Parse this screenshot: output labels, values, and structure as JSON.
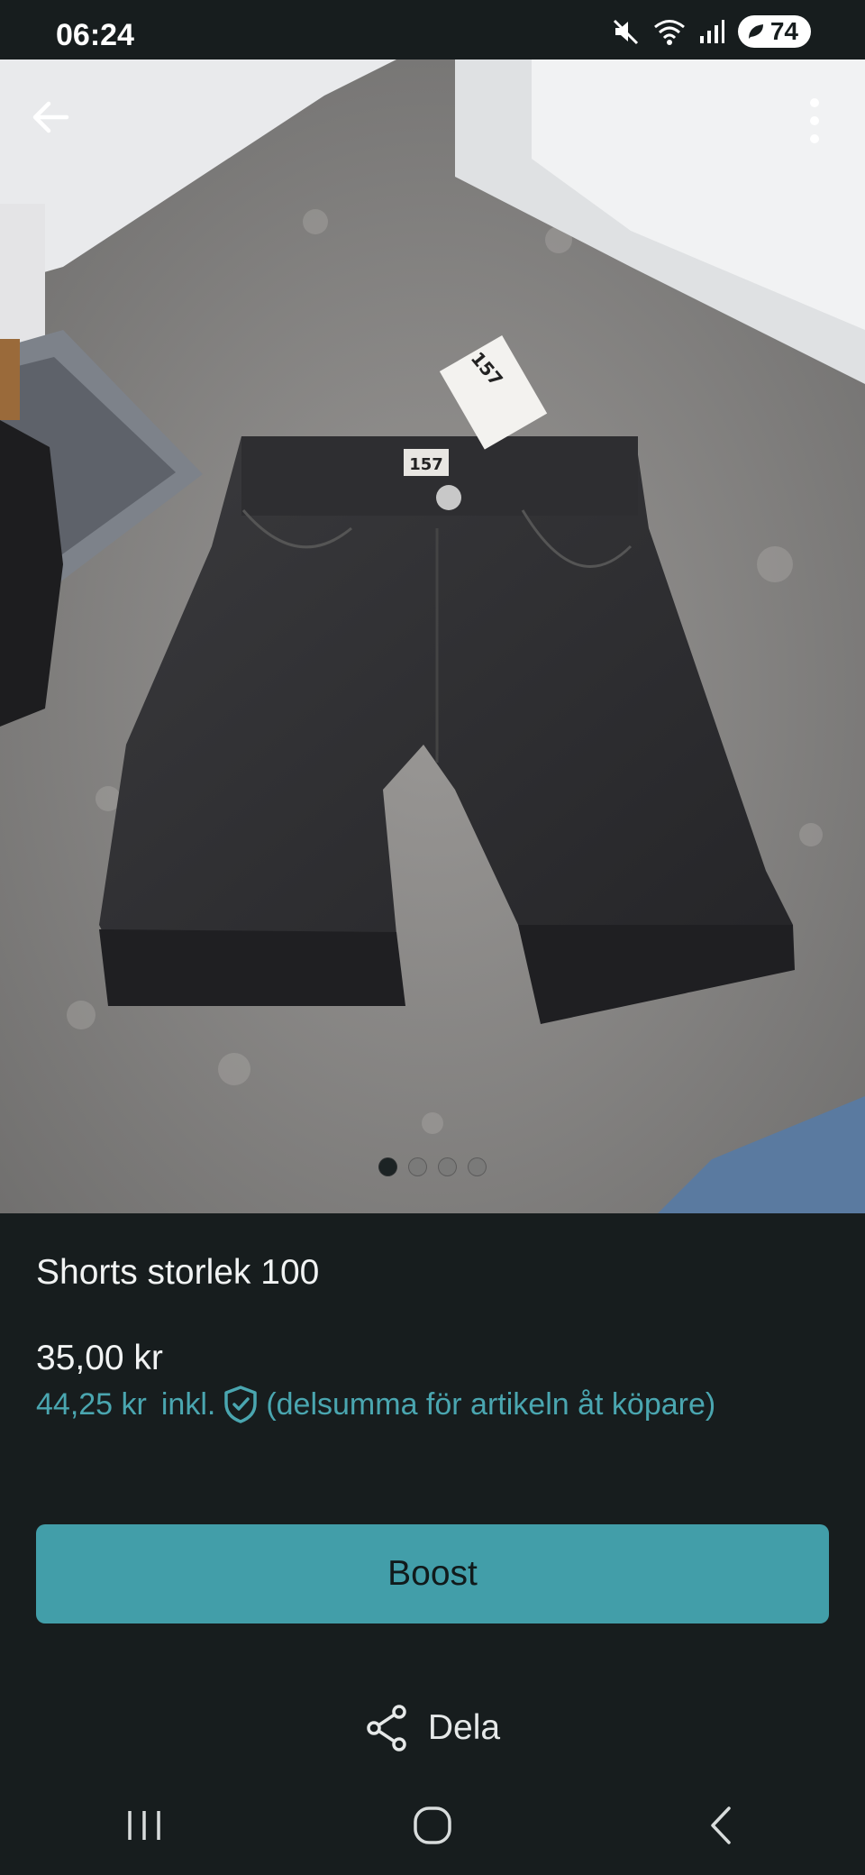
{
  "status": {
    "time": "06:24",
    "battery": "74"
  },
  "product": {
    "title": "Shorts storlek 100",
    "price": "35,00 kr",
    "price_incl_amount": "44,25 kr",
    "price_incl_label": "inkl.",
    "price_incl_note": "(delsumma för artikeln åt köpare)"
  },
  "photo": {
    "tag_text": "157",
    "tag_text_2": "157",
    "page_count": 4,
    "active_page": 1
  },
  "actions": {
    "boost_label": "Boost",
    "share_label": "Dela"
  },
  "colors": {
    "accent": "#429ea9",
    "accent_text": "#4aa6b0",
    "background": "#171d1e"
  },
  "icons": [
    "back-arrow-icon",
    "more-vert-icon",
    "shield-check-icon",
    "share-icon",
    "recents-icon",
    "home-icon",
    "nav-back-icon",
    "mute-icon",
    "wifi-icon",
    "signal-icon",
    "battery-saver-icon"
  ]
}
